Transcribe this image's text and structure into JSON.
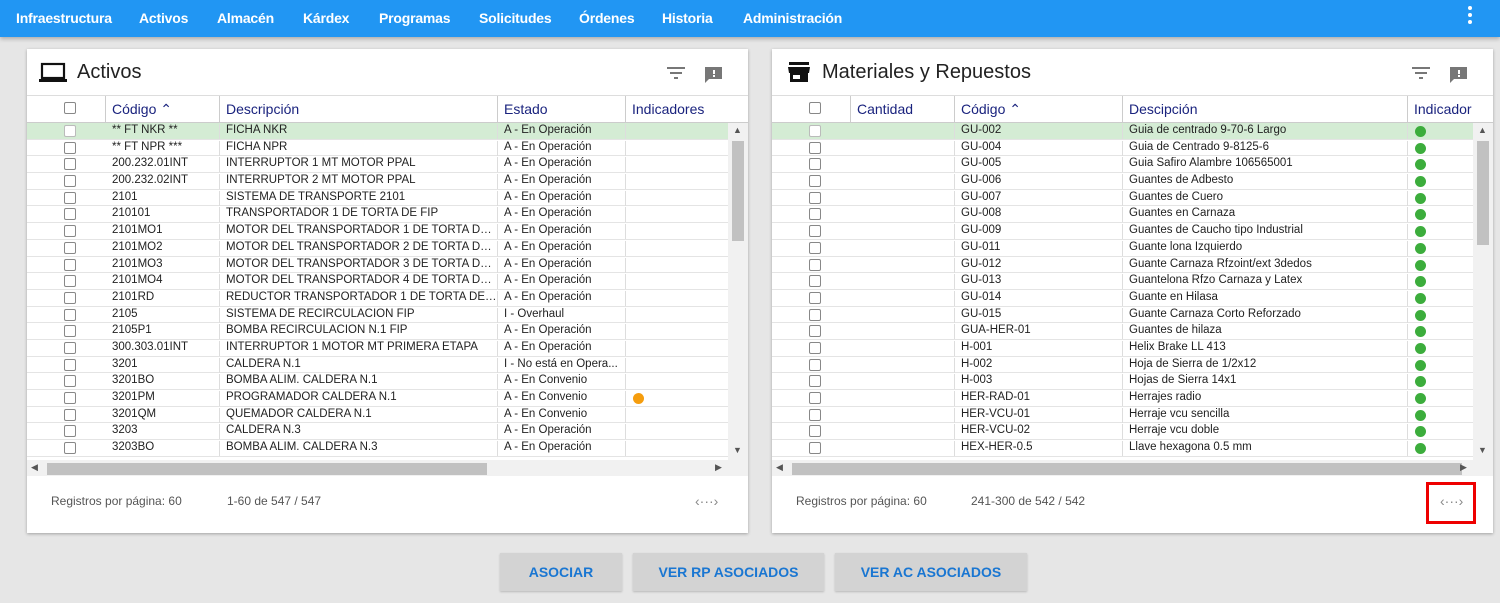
{
  "nav": [
    "Infraestructura",
    "Activos",
    "Almacén",
    "Kárdex",
    "Programas",
    "Solicitudes",
    "Órdenes",
    "Historia",
    "Administración"
  ],
  "left": {
    "title": "Activos",
    "columns": [
      "Código",
      "Descripción",
      "Estado",
      "Indicadores"
    ],
    "rows": [
      [
        "** FT NKR **",
        "FICHA NKR",
        "A - En Operación",
        ""
      ],
      [
        "** FT NPR ***",
        "FICHA NPR",
        "A - En Operación",
        ""
      ],
      [
        "200.232.01INT",
        "INTERRUPTOR 1 MT MOTOR PPAL",
        "A - En Operación",
        ""
      ],
      [
        "200.232.02INT",
        "INTERRUPTOR 2 MT MOTOR PPAL",
        "A - En Operación",
        ""
      ],
      [
        "2101",
        "SISTEMA DE TRANSPORTE 2101",
        "A - En Operación",
        ""
      ],
      [
        "210101",
        "TRANSPORTADOR 1 DE TORTA DE FIP",
        "A - En Operación",
        ""
      ],
      [
        "2101MO1",
        "MOTOR DEL TRANSPORTADOR 1 DE TORTA DE F...",
        "A - En Operación",
        ""
      ],
      [
        "2101MO2",
        "MOTOR DEL TRANSPORTADOR 2 DE TORTA DE F...",
        "A - En Operación",
        ""
      ],
      [
        "2101MO3",
        "MOTOR DEL TRANSPORTADOR 3 DE TORTA DE F...",
        "A - En Operación",
        ""
      ],
      [
        "2101MO4",
        "MOTOR DEL TRANSPORTADOR 4 DE TORTA DE F...",
        "A - En Operación",
        ""
      ],
      [
        "2101RD",
        "REDUCTOR TRANSPORTADOR 1 DE TORTA DE FIP",
        "A - En Operación",
        ""
      ],
      [
        "2105",
        "SISTEMA DE RECIRCULACION FIP",
        "I - Overhaul",
        ""
      ],
      [
        "2105P1",
        "BOMBA RECIRCULACION N.1 FIP",
        "A - En Operación",
        ""
      ],
      [
        "300.303.01INT",
        "INTERRUPTOR 1 MOTOR MT PRIMERA ETAPA",
        "A - En Operación",
        ""
      ],
      [
        "3201",
        "CALDERA N.1",
        "I - No está en Opera...",
        ""
      ],
      [
        "3201BO",
        "BOMBA ALIM. CALDERA N.1",
        "A - En Convenio",
        ""
      ],
      [
        "3201PM",
        "PROGRAMADOR CALDERA N.1",
        "A - En Convenio",
        "orange"
      ],
      [
        "3201QM",
        "QUEMADOR CALDERA N.1",
        "A - En Convenio",
        ""
      ],
      [
        "3203",
        "CALDERA N.3",
        "A - En Operación",
        ""
      ],
      [
        "3203BO",
        "BOMBA ALIM. CALDERA N.3",
        "A - En Operación",
        ""
      ]
    ],
    "footer_perpage": "Registros por página: 60",
    "footer_range": "1-60 de 547 / 547"
  },
  "right": {
    "title": "Materiales y Repuestos",
    "columns": [
      "Cantidad",
      "Código",
      "Descipción",
      "Indicador"
    ],
    "rows": [
      [
        "",
        "GU-002",
        "Guia de centrado 9-70-6 Largo",
        "green"
      ],
      [
        "",
        "GU-004",
        "Guia de Centrado 9-8125-6",
        "green"
      ],
      [
        "",
        "GU-005",
        "Guia Safiro Alambre 106565001",
        "green"
      ],
      [
        "",
        "GU-006",
        "Guantes de Adbesto",
        "green"
      ],
      [
        "",
        "GU-007",
        "Guantes de Cuero",
        "green"
      ],
      [
        "",
        "GU-008",
        "Guantes en Carnaza",
        "green"
      ],
      [
        "",
        "GU-009",
        "Guantes de Caucho tipo Industrial",
        "green"
      ],
      [
        "",
        "GU-011",
        "Guante lona Izquierdo",
        "green"
      ],
      [
        "",
        "GU-012",
        "Guante Carnaza Rfzoint/ext 3dedos",
        "green"
      ],
      [
        "",
        "GU-013",
        "Guantelona Rfzo Carnaza y Latex",
        "green"
      ],
      [
        "",
        "GU-014",
        "Guante en Hilasa",
        "green"
      ],
      [
        "",
        "GU-015",
        "Guante Carnaza Corto Reforzado",
        "green"
      ],
      [
        "",
        "GUA-HER-01",
        "Guantes de hilaza",
        "green"
      ],
      [
        "",
        "H-001",
        "Helix Brake LL 413",
        "green"
      ],
      [
        "",
        "H-002",
        "Hoja de Sierra de 1/2x12",
        "green"
      ],
      [
        "",
        "H-003",
        "Hojas de Sierra 14x1",
        "green"
      ],
      [
        "",
        "HER-RAD-01",
        "Herrajes radio",
        "green"
      ],
      [
        "",
        "HER-VCU-01",
        "Herraje vcu sencilla",
        "green"
      ],
      [
        "",
        "HER-VCU-02",
        "Herraje vcu doble",
        "green"
      ],
      [
        "",
        "HEX-HER-0.5",
        "Llave hexagona 0.5 mm",
        "green"
      ]
    ],
    "footer_perpage": "Registros por página: 60",
    "footer_range": "241-300 de 542 / 542"
  },
  "buttons": [
    "ASOCIAR",
    "VER RP ASOCIADOS",
    "VER AC ASOCIADOS"
  ],
  "icons": {
    "expand": "‹···›"
  }
}
